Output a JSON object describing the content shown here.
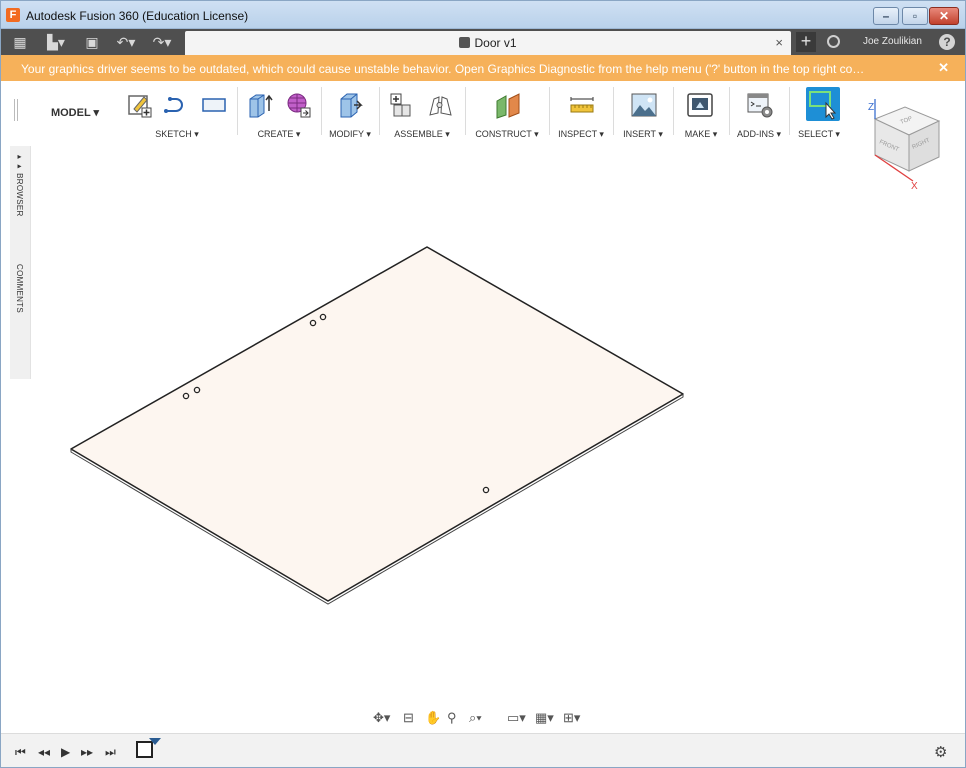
{
  "window": {
    "title": "Autodesk Fusion 360 (Education License)",
    "logo_letter": "F",
    "minimize": "–",
    "restore": "▫",
    "close": "✕"
  },
  "tabbar": {
    "document_tab": "Door v1",
    "close_tab": "×",
    "new_tab": "+",
    "user": "Joe Zoulikian",
    "help": "?"
  },
  "banner": {
    "text": "Your graphics driver seems to be outdated, which could cause unstable behavior. Open Graphics Diagnostic from the help menu ('?' button in the top right co…",
    "close": "✕"
  },
  "toolbar": {
    "workspace": "MODEL ▾",
    "groups": [
      {
        "label": "SKETCH ▾"
      },
      {
        "label": "CREATE ▾"
      },
      {
        "label": "MODIFY ▾"
      },
      {
        "label": "ASSEMBLE ▾"
      },
      {
        "label": "CONSTRUCT ▾"
      },
      {
        "label": "INSPECT ▾"
      },
      {
        "label": "INSERT ▾"
      },
      {
        "label": "MAKE ▾"
      },
      {
        "label": "ADD-INS ▾"
      },
      {
        "label": "SELECT ▾"
      }
    ]
  },
  "sidepanel": {
    "browser": "▸▸ BROWSER",
    "comments": "COMMENTS"
  },
  "viewcube": {
    "top": "TOP",
    "front": "FRONT",
    "right": "RIGHT",
    "axis_z": "Z",
    "axis_x": "X"
  },
  "colors": {
    "banner": "#f6b15a",
    "tabbar": "#4f4f4f",
    "body_fill": "#fdf6f0",
    "select_accent": "#1e8fd6"
  }
}
